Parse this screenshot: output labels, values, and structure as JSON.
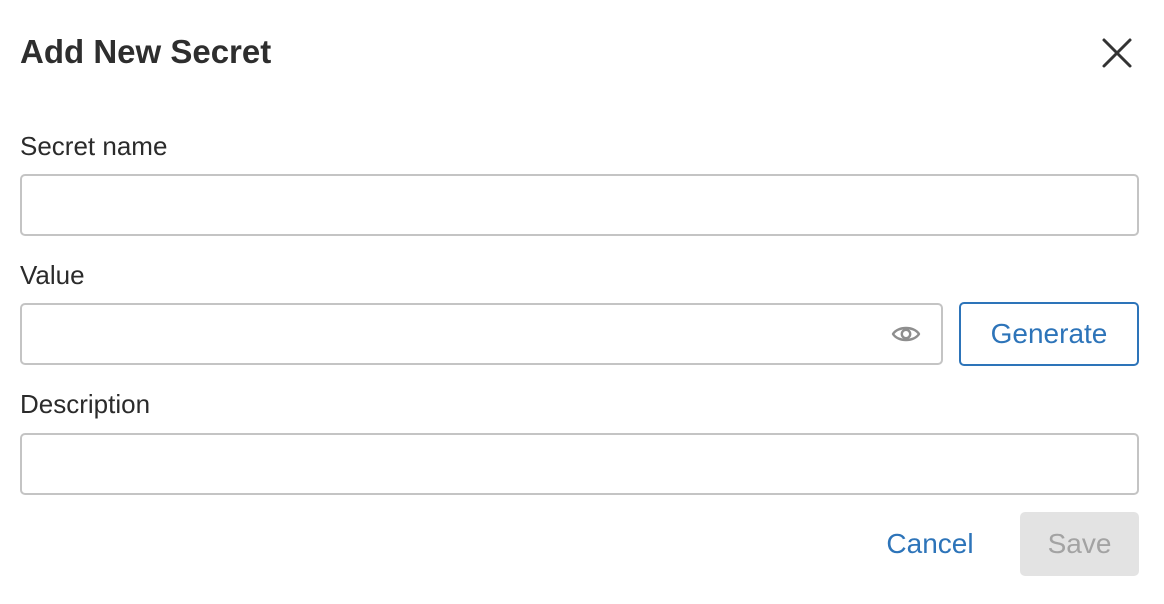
{
  "dialog": {
    "title": "Add New Secret"
  },
  "fields": {
    "name": {
      "label": "Secret name",
      "value": "",
      "placeholder": ""
    },
    "value": {
      "label": "Value",
      "value": "",
      "placeholder": ""
    },
    "description": {
      "label": "Description",
      "value": "",
      "placeholder": ""
    }
  },
  "buttons": {
    "generate": "Generate",
    "cancel": "Cancel",
    "save": "Save"
  },
  "icons": {
    "close": "close-icon",
    "reveal": "eye-icon"
  },
  "colors": {
    "accent": "#2d74b9",
    "disabled_bg": "#e3e3e3",
    "disabled_text": "#a3a3a3",
    "border": "#c4c4c4"
  }
}
